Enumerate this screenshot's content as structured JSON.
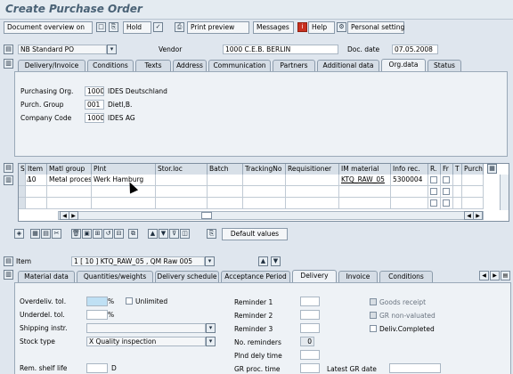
{
  "window": {
    "title": "Create Purchase Order"
  },
  "toolbar": {
    "document_overview": "Document overview on",
    "hold": "Hold",
    "print_preview": "Print preview",
    "messages": "Messages",
    "help": "Help",
    "personal_setting": "Personal setting"
  },
  "header": {
    "doc_type": "NB Standard PO",
    "vendor_label": "Vendor",
    "vendor_value": "1000 C.E.B. BERLIN",
    "doc_date_label": "Doc. date",
    "doc_date_value": "07.05.2008"
  },
  "header_tabs": [
    "Delivery/Invoice",
    "Conditions",
    "Texts",
    "Address",
    "Communication",
    "Partners",
    "Additional data",
    "Org.data",
    "Status"
  ],
  "org": {
    "purch_org_label": "Purchasing Org.",
    "purch_org_code": "1000",
    "purch_org_name": "IDES Deutschland",
    "purch_group_label": "Purch. Group",
    "purch_group_code": "001",
    "purch_group_name": "Dietl,B.",
    "company_code_label": "Company Code",
    "company_code_code": "1000",
    "company_code_name": "IDES AG"
  },
  "items_grid": {
    "columns": [
      "S",
      "Item",
      "Matl group",
      "Plnt",
      "Stor.loc",
      "Batch",
      "TrackingNo",
      "Requisitioner",
      "IM material",
      "Info rec.",
      "R.",
      "Fr",
      "T",
      "Purch"
    ],
    "row1": {
      "item": "10",
      "matl_group": "Metal process",
      "plant": "Werk Hamburg",
      "im_material": "KTQ_RAW_05",
      "info_rec": "5300004"
    }
  },
  "grid_toolbar": {
    "default_values": "Default values"
  },
  "item_detail": {
    "item_label": "Item",
    "item_value": "1 [ 10 ] KTQ_RAW_05 , QM Raw 005",
    "tabs": [
      "Material data",
      "Quantities/weights",
      "Delivery schedule",
      "Acceptance Period",
      "Delivery",
      "Invoice",
      "Conditions"
    ]
  },
  "delivery": {
    "overdeliv_label": "Overdeliv. tol.",
    "underdel_label": "Underdel. tol.",
    "percent": "%",
    "unlimited": "Unlimited",
    "shipping_instr_label": "Shipping instr.",
    "stock_type_label": "Stock type",
    "stock_type_value": "X Quality inspection",
    "rem_shelf_life_label": "Rem. shelf life",
    "rem_shelf_life_unit": "D",
    "reminder1": "Reminder 1",
    "reminder2": "Reminder 2",
    "reminder3": "Reminder 3",
    "no_reminders": "No. reminders",
    "no_reminders_value": "0",
    "plnd_dely_time": "Plnd dely time",
    "gr_proc_time": "GR proc. time",
    "latest_gr_date": "Latest GR date",
    "goods_receipt": "Goods receipt",
    "gr_non_valuated": "GR non-valuated",
    "deliv_completed": "Deliv.Completed"
  }
}
